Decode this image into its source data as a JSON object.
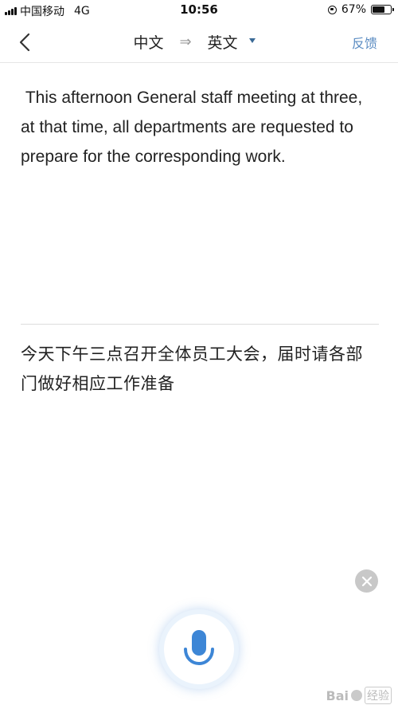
{
  "status_bar": {
    "carrier": "中国移动",
    "network": "4G",
    "time": "10:56",
    "battery_percent": "67%",
    "battery_level": 0.67
  },
  "nav": {
    "source_lang": "中文",
    "arrow": "⇒",
    "target_lang": "英文",
    "feedback_label": "反馈"
  },
  "translation": {
    "text": " This afternoon General staff meeting at three, at that time, all departments are requested to prepare for the corresponding work."
  },
  "source": {
    "text": "今天下午三点召开全体员工大会，届时请各部门做好相应工作准备"
  },
  "watermark": {
    "brand": "Bai",
    "suffix": "经验"
  },
  "colors": {
    "accent": "#5b8cc2",
    "mic_blue": "#3d86d6",
    "caret": "#3a6a96"
  },
  "icons": {
    "back": "chevron-left-icon",
    "clear": "close-icon",
    "mic": "microphone-icon"
  }
}
